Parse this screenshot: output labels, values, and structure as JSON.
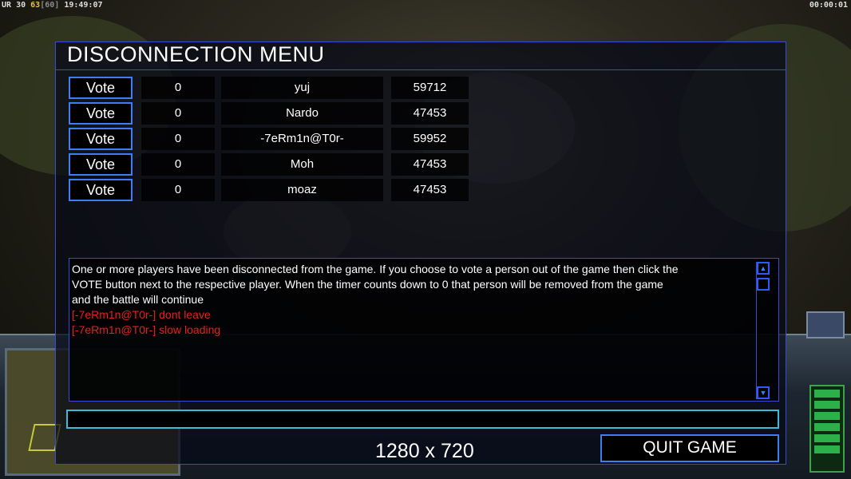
{
  "hud": {
    "prefix": "UR",
    "fps": "30",
    "fps_current": "63",
    "fps_limit": "[60]",
    "clock": "19:49:07",
    "game_timer": "00:00:01"
  },
  "dialog": {
    "title": "DISCONNECTION MENU",
    "players": [
      {
        "vote_label": "Vote",
        "votes": "0",
        "name": "yuj",
        "ping": "59712"
      },
      {
        "vote_label": "Vote",
        "votes": "0",
        "name": "Nardo",
        "ping": "47453"
      },
      {
        "vote_label": "Vote",
        "votes": "0",
        "name": "-7eRm1n@T0r-",
        "ping": "59952"
      },
      {
        "vote_label": "Vote",
        "votes": "0",
        "name": "Moh",
        "ping": "47453"
      },
      {
        "vote_label": "Vote",
        "votes": "0",
        "name": "moaz",
        "ping": "47453"
      }
    ],
    "messages": {
      "info_1": "One or more players have been disconnected from the game. If you choose to vote a person out of the game then click the",
      "info_2": " VOTE button next to the respective player. When the timer counts down to 0 that person will be removed from the game",
      "info_3": " and the battle will continue",
      "chat": [
        "[-7eRm1n@T0r-] dont leave",
        "[-7eRm1n@T0r-] slow loading"
      ]
    },
    "chat_input_value": "",
    "resolution": "1280 x 720",
    "quit_label": "QUIT GAME"
  },
  "colors": {
    "border_blue": "#3f7ef0",
    "chat_red": "#ee1d1d",
    "input_cyan": "#3fb9d8"
  },
  "icons": {
    "scroll_up": "triangle-up-icon",
    "scroll_down": "triangle-down-icon"
  }
}
